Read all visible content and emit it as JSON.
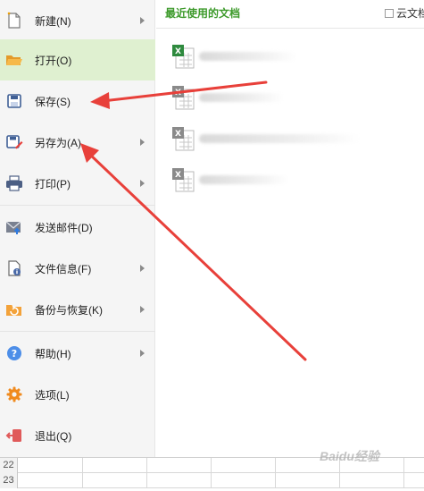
{
  "menu": {
    "items": [
      {
        "label": "新建(N)",
        "icon": "new-file-icon",
        "has_submenu": true
      },
      {
        "label": "打开(O)",
        "icon": "open-folder-icon",
        "has_submenu": false,
        "active": true
      },
      {
        "label": "保存(S)",
        "icon": "save-icon",
        "has_submenu": false
      },
      {
        "label": "另存为(A)",
        "icon": "save-as-icon",
        "has_submenu": true
      },
      {
        "label": "打印(P)",
        "icon": "print-icon",
        "has_submenu": true
      },
      {
        "label": "发送邮件(D)",
        "icon": "send-mail-icon",
        "has_submenu": false
      },
      {
        "label": "文件信息(F)",
        "icon": "file-info-icon",
        "has_submenu": true
      },
      {
        "label": "备份与恢复(K)",
        "icon": "backup-restore-icon",
        "has_submenu": true
      },
      {
        "label": "帮助(H)",
        "icon": "help-icon",
        "has_submenu": true
      },
      {
        "label": "选项(L)",
        "icon": "options-gear-icon",
        "has_submenu": false
      },
      {
        "label": "退出(Q)",
        "icon": "exit-icon",
        "has_submenu": false
      }
    ]
  },
  "recent": {
    "title": "最近使用的文档",
    "cloud_checkbox_label": "云文档"
  },
  "grid": {
    "rows": [
      "22",
      "23"
    ]
  },
  "watermark": "Baidu经验",
  "colors": {
    "accent_green": "#3d9a2b",
    "active_bg": "#dff0d0",
    "arrow_red": "#e8403a"
  }
}
